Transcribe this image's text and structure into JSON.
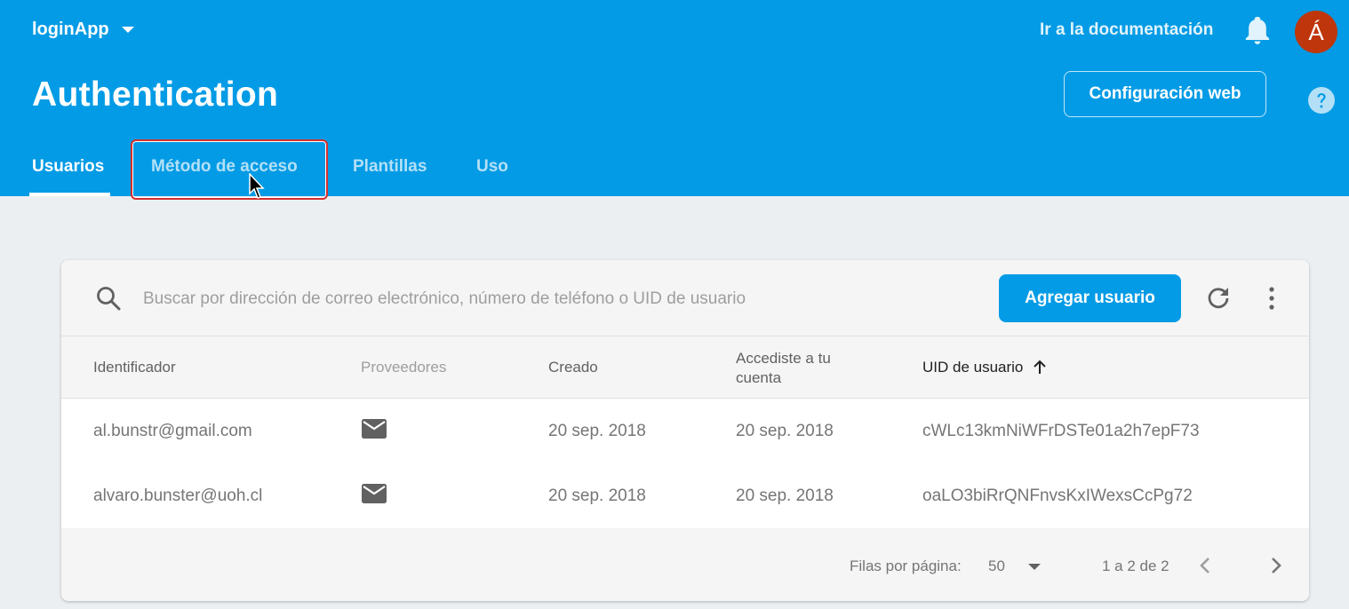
{
  "colors": {
    "brand": "#039be5",
    "avatar_bg": "#bf360c",
    "highlight": "#d32f2f"
  },
  "header": {
    "project_name": "loginApp",
    "doc_link": "Ir a la documentación",
    "avatar_letter": "Á",
    "title": "Authentication",
    "config_button": "Configuración web",
    "icons": [
      "bell-icon",
      "help-icon",
      "chevron-down-icon"
    ]
  },
  "tabs": [
    {
      "label": "Usuarios",
      "active": true
    },
    {
      "label": "Método de acceso",
      "active": false
    },
    {
      "label": "Plantillas",
      "active": false
    },
    {
      "label": "Uso",
      "active": false
    }
  ],
  "toolbar": {
    "search_placeholder": "Buscar por dirección de correo electrónico, número de teléfono o UID de usuario",
    "add_button": "Agregar usuario",
    "icons": [
      "search-icon",
      "refresh-icon",
      "more-vert-icon"
    ]
  },
  "table": {
    "columns": [
      "Identificador",
      "Proveedores",
      "Creado",
      "Accediste a tu cuenta",
      "UID de usuario"
    ],
    "sort_indicator": "arrow-up-icon",
    "rows": [
      {
        "identifier": "al.bunstr@gmail.com",
        "provider": "email-icon",
        "created": "20 sep. 2018",
        "signed_in": "20 sep. 2018",
        "uid": "cWLc13kmNiWFrDSTe01a2h7epF73"
      },
      {
        "identifier": "alvaro.bunster@uoh.cl",
        "provider": "email-icon",
        "created": "20 sep. 2018",
        "signed_in": "20 sep. 2018",
        "uid": "oaLO3biRrQNFnvsKxIWexsCcPg72"
      }
    ]
  },
  "pagination": {
    "rows_per_page_label": "Filas por página:",
    "rows_per_page": "50",
    "range": "1 a 2 de 2"
  }
}
